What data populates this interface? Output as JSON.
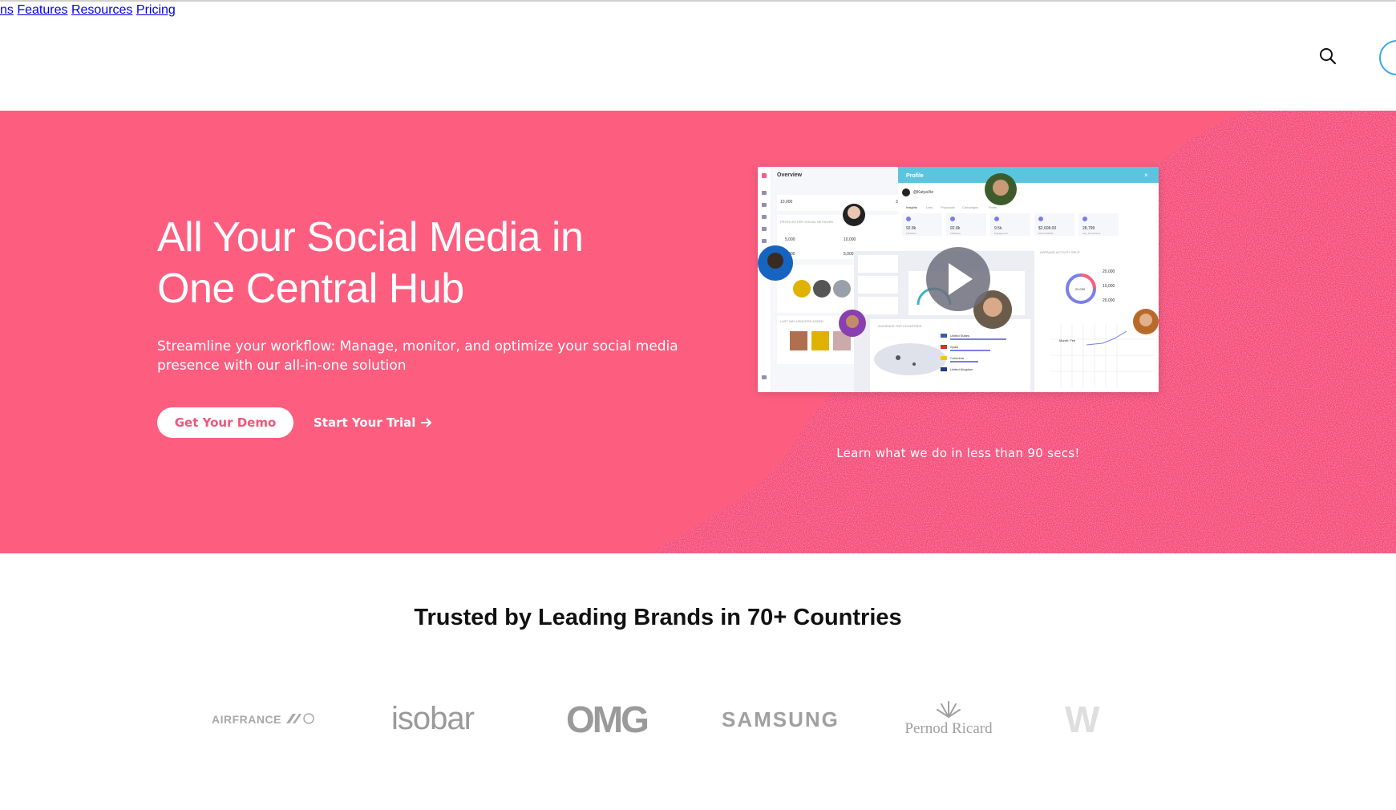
{
  "nav": {
    "items": [
      "ns",
      "Features",
      "Resources",
      "Pricing"
    ]
  },
  "icons": {
    "search": "search-icon",
    "account": "account-circle-icon",
    "play": "play-icon",
    "arrow": "arrow-right-icon"
  },
  "hero": {
    "title_line1": "All Your Social Media in",
    "title_line2": "One Central Hub",
    "subtitle": "Streamline your workflow: Manage, monitor, and optimize your social media presence with our all-in-one solution",
    "demo_button": "Get Your Demo",
    "trial_button": "Start Your Trial",
    "video_caption": "Learn what we do in less than 90 secs!",
    "background_color": "#fd5e80"
  },
  "video": {
    "overview_title": "Overview",
    "profile_title": "Profile",
    "handle": "@KatyaVie",
    "tabs": [
      "Insights",
      "Lists",
      "Proposals",
      "Campaigns",
      "Posts"
    ],
    "stats": [
      "92.8k",
      "92.8k",
      "9.5k",
      "$2,608.00",
      "28,799"
    ],
    "stat_labels": [
      "Followers",
      "Following",
      "Engagement",
      "Earned Media",
      "Avg. Interactions"
    ],
    "section_profiles": "PROFILES PER SOCIAL NETWORK",
    "section_last": "LAST INFLUENCERS ADDED",
    "section_countries": "AUDIENCE TOP COUNTRIES",
    "section_activity": "AVERAGE ACTIVITY SPLIT",
    "countries": [
      "United States",
      "Spain",
      "Colombia",
      "United Kingdom"
    ],
    "activity_values": [
      "20,000",
      "10,000",
      "20,000"
    ],
    "donut_center": "20,000",
    "month_label": "Month: Feb",
    "small_numbers": [
      "10,000",
      "3,000",
      "5,000",
      "10,000",
      "5,000",
      "5,000",
      "5,000",
      "30,000"
    ]
  },
  "trusted": {
    "heading": "Trusted by Leading Brands in 70+ Countries",
    "logos": [
      "AIRFRANCE",
      "isobar",
      "OMG",
      "SAMSUNG",
      "Pernod Ricard",
      "W"
    ]
  }
}
